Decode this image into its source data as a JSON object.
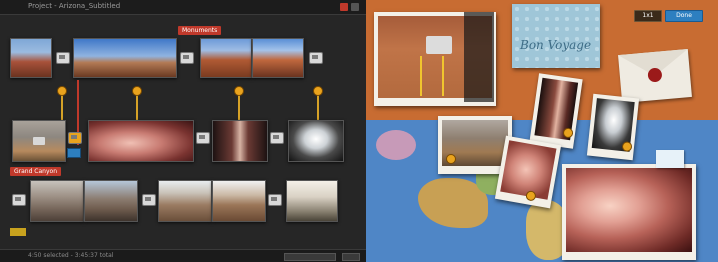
{
  "window": {
    "title": "Project - Arizona_Subtitled"
  },
  "rows": [
    {
      "label": "Monuments"
    },
    {
      "label": "Grand Canyon"
    }
  ],
  "status": {
    "text": "4:50 selected - 3:45:37 total"
  },
  "board": {
    "buttons": [
      {
        "label": "1x1"
      },
      {
        "label": "Done"
      }
    ],
    "postcard_text": "Bon Voyage"
  },
  "colors": {
    "accent_red": "#c0392b",
    "marker_gold": "#e9a31e",
    "board_cork": "#c86c32",
    "done_blue": "#2d7fc0"
  },
  "icons": [
    "close-icon",
    "minimize-icon",
    "transition-icon",
    "marker-pin-icon",
    "envelope-icon",
    "wax-seal-icon"
  ]
}
